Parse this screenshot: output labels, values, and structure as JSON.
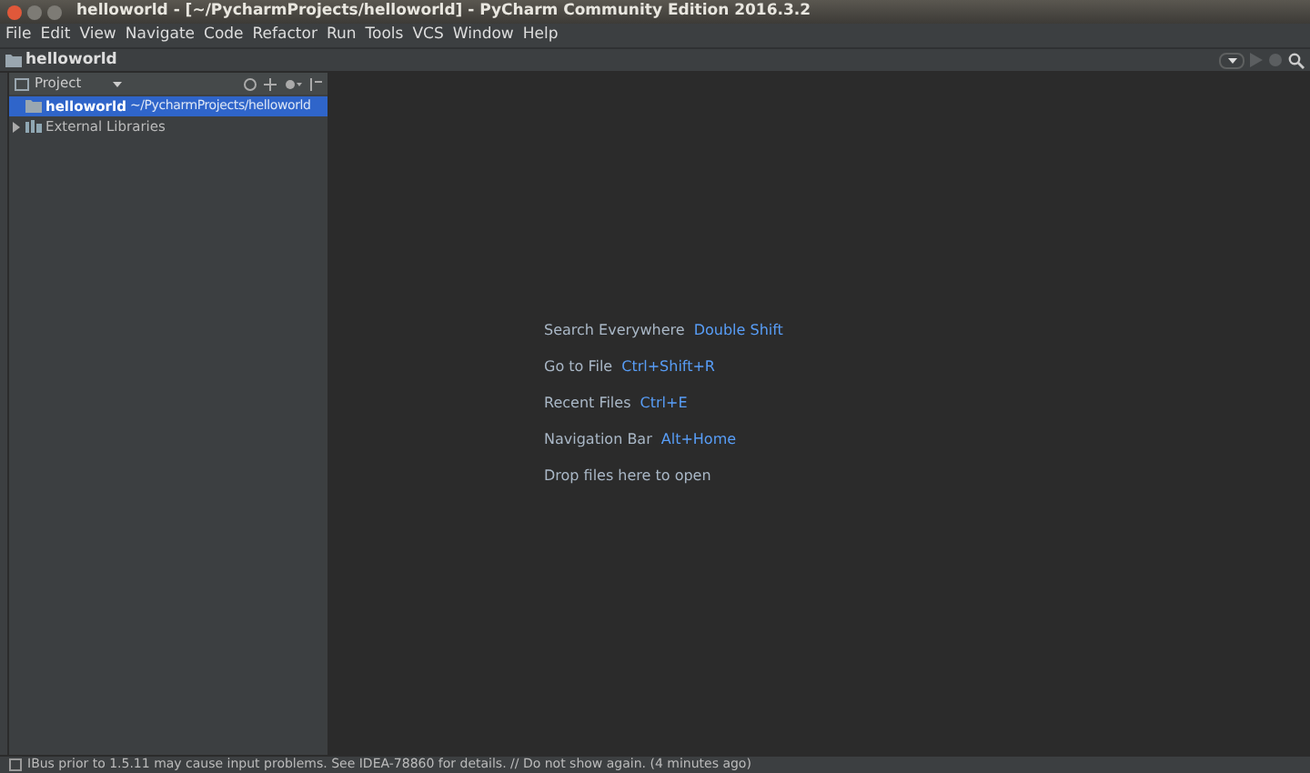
{
  "window": {
    "title": "helloworld - [~/PycharmProjects/helloworld] - PyCharm Community Edition 2016.3.2"
  },
  "menu": [
    "File",
    "Edit",
    "View",
    "Navigate",
    "Code",
    "Refactor",
    "Run",
    "Tools",
    "VCS",
    "Window",
    "Help"
  ],
  "breadcrumb": "helloworld",
  "project_panel": {
    "title": "Project",
    "items": [
      {
        "name": "helloworld",
        "path": "~/PycharmProjects/helloworld",
        "kind": "folder",
        "selected": true,
        "has_arrow": false
      },
      {
        "name": "External Libraries",
        "kind": "library",
        "selected": false,
        "expanded": false,
        "has_arrow": true
      }
    ]
  },
  "hints": [
    {
      "label": "Search Everywhere",
      "shortcut": "Double Shift"
    },
    {
      "label": "Go to File",
      "shortcut": "Ctrl+Shift+R"
    },
    {
      "label": "Recent Files",
      "shortcut": "Ctrl+E"
    },
    {
      "label": "Navigation Bar",
      "shortcut": "Alt+Home"
    },
    {
      "label": "Drop files here to open"
    }
  ],
  "status_bar": "IBus prior to 1.5.11 may cause input problems. See IDEA-78860 for details. // Do not show again. (4 minutes ago)"
}
